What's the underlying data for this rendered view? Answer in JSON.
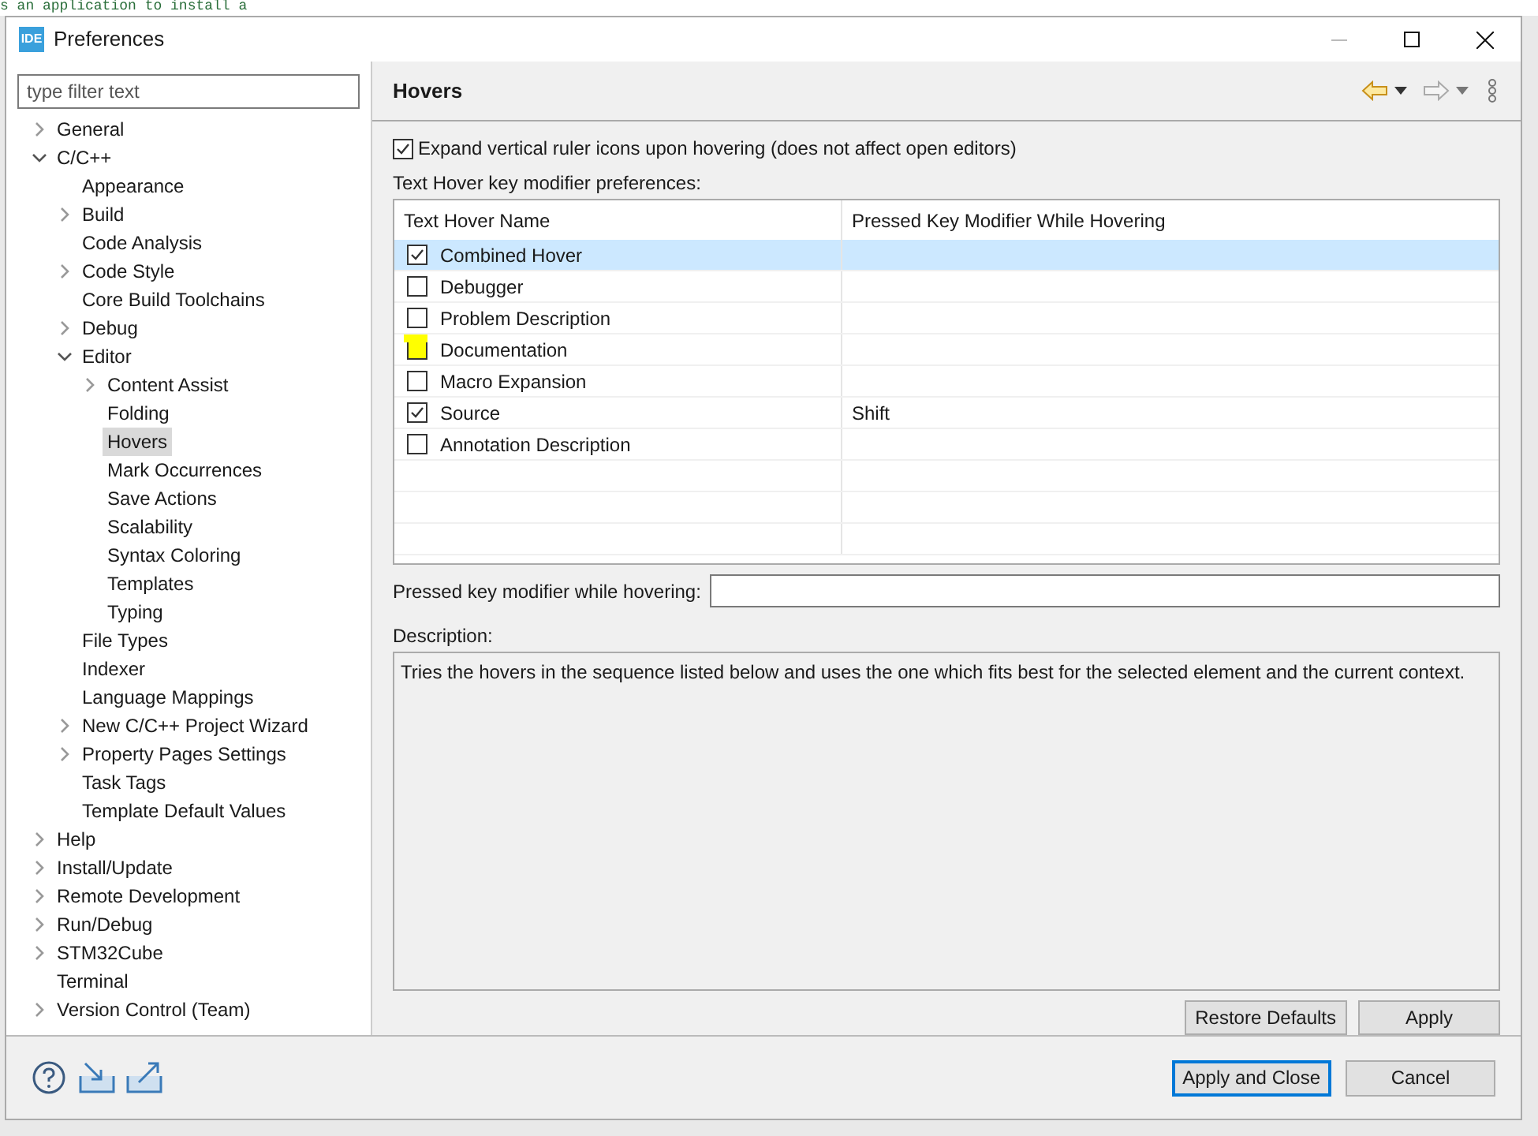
{
  "background_editor": {
    "text": "s an application to install a"
  },
  "window": {
    "title": "Preferences",
    "logo": "IDE"
  },
  "filter": {
    "placeholder": "type filter text"
  },
  "tree": [
    {
      "label": "General",
      "expanded": false,
      "selected": false
    },
    {
      "label": "C/C++",
      "expanded": true,
      "selected": false,
      "children": [
        {
          "label": "Appearance",
          "selected": false
        },
        {
          "label": "Build",
          "expanded": false,
          "selected": false
        },
        {
          "label": "Code Analysis",
          "selected": false
        },
        {
          "label": "Code Style",
          "expanded": false,
          "selected": false
        },
        {
          "label": "Core Build Toolchains",
          "selected": false
        },
        {
          "label": "Debug",
          "expanded": false,
          "selected": false
        },
        {
          "label": "Editor",
          "expanded": true,
          "selected": false,
          "children": [
            {
              "label": "Content Assist",
              "expanded": false,
              "selected": false
            },
            {
              "label": "Folding",
              "selected": false
            },
            {
              "label": "Hovers",
              "selected": true
            },
            {
              "label": "Mark Occurrences",
              "selected": false
            },
            {
              "label": "Save Actions",
              "selected": false
            },
            {
              "label": "Scalability",
              "selected": false
            },
            {
              "label": "Syntax Coloring",
              "selected": false
            },
            {
              "label": "Templates",
              "selected": false
            },
            {
              "label": "Typing",
              "selected": false
            }
          ]
        },
        {
          "label": "File Types",
          "selected": false
        },
        {
          "label": "Indexer",
          "selected": false
        },
        {
          "label": "Language Mappings",
          "selected": false
        },
        {
          "label": "New C/C++ Project Wizard",
          "expanded": false,
          "selected": false
        },
        {
          "label": "Property Pages Settings",
          "expanded": false,
          "selected": false
        },
        {
          "label": "Task Tags",
          "selected": false
        },
        {
          "label": "Template Default Values",
          "selected": false
        }
      ]
    },
    {
      "label": "Help",
      "expanded": false,
      "selected": false
    },
    {
      "label": "Install/Update",
      "expanded": false,
      "selected": false
    },
    {
      "label": "Remote Development",
      "expanded": false,
      "selected": false
    },
    {
      "label": "Run/Debug",
      "expanded": false,
      "selected": false
    },
    {
      "label": "STM32Cube",
      "expanded": false,
      "selected": false
    },
    {
      "label": "Terminal",
      "selected": false
    },
    {
      "label": "Version Control (Team)",
      "expanded": false,
      "selected": false
    }
  ],
  "page": {
    "title": "Hovers",
    "expand_option": {
      "label": "Expand vertical ruler icons upon hovering (does not affect open editors)",
      "checked": true
    },
    "table_label": "Text Hover key modifier preferences:",
    "table": {
      "columns": [
        "Text Hover Name",
        "Pressed Key Modifier While Hovering"
      ],
      "rows": [
        {
          "name": "Combined Hover",
          "checked": true,
          "selected": true,
          "highlighted": false
        },
        {
          "name": "Debugger",
          "checked": false,
          "selected": false,
          "highlighted": false
        },
        {
          "name": "Problem Description",
          "checked": false,
          "selected": false,
          "highlighted": false
        },
        {
          "name": "Documentation",
          "checked": false,
          "selected": false,
          "highlighted": true
        },
        {
          "name": "Macro Expansion",
          "checked": false,
          "selected": false,
          "highlighted": false
        },
        {
          "name": "Source",
          "modifier": "Shift",
          "checked": true,
          "selected": false,
          "highlighted": false
        },
        {
          "name": "Annotation Description",
          "checked": false,
          "selected": false,
          "highlighted": false
        }
      ]
    },
    "modifier_field": {
      "label": "Pressed key modifier while hovering:"
    },
    "description_label": "Description:",
    "description": "Tries the hovers in the sequence listed below and uses the one which fits best for the selected element and the current context.",
    "page_buttons": [
      "Restore Defaults",
      "Apply"
    ]
  },
  "footer_buttons": [
    {
      "label": "Apply and Close",
      "default": true
    },
    {
      "label": "Cancel",
      "default": false
    }
  ]
}
